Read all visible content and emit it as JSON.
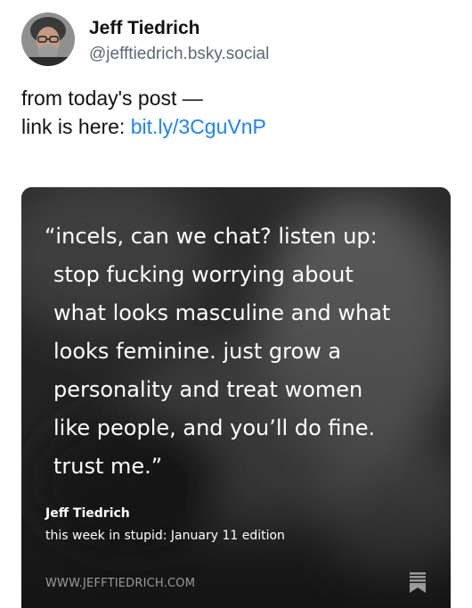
{
  "author": {
    "name": "Jeff Tiedrich",
    "handle": "@jefftiedrich.bsky.social",
    "avatar_icon": "bearded-man-avatar"
  },
  "post": {
    "line1": "from today's post —",
    "line2_prefix": "link is here: ",
    "link_text": "bit.ly/3CguVnP"
  },
  "card": {
    "quote_lines": [
      "“incels, can we chat? listen up:",
      "stop fucking worrying about",
      "what looks masculine and what",
      "looks feminine. just grow a",
      "personality and treat women",
      "like people, and you’ll do fine.",
      "trust me.”"
    ],
    "author": "Jeff Tiedrich",
    "edition": "this week in stupid: January 11 edition",
    "site": "WWW.JEFFTIEDRICH.COM",
    "bookmark_icon": "bookmark-icon"
  },
  "colors": {
    "link": "#1d83f5",
    "handle": "#5c6773",
    "card_bg": "#2a2a2a",
    "card_text": "#ffffff",
    "site_text": "#9a9a9a"
  }
}
